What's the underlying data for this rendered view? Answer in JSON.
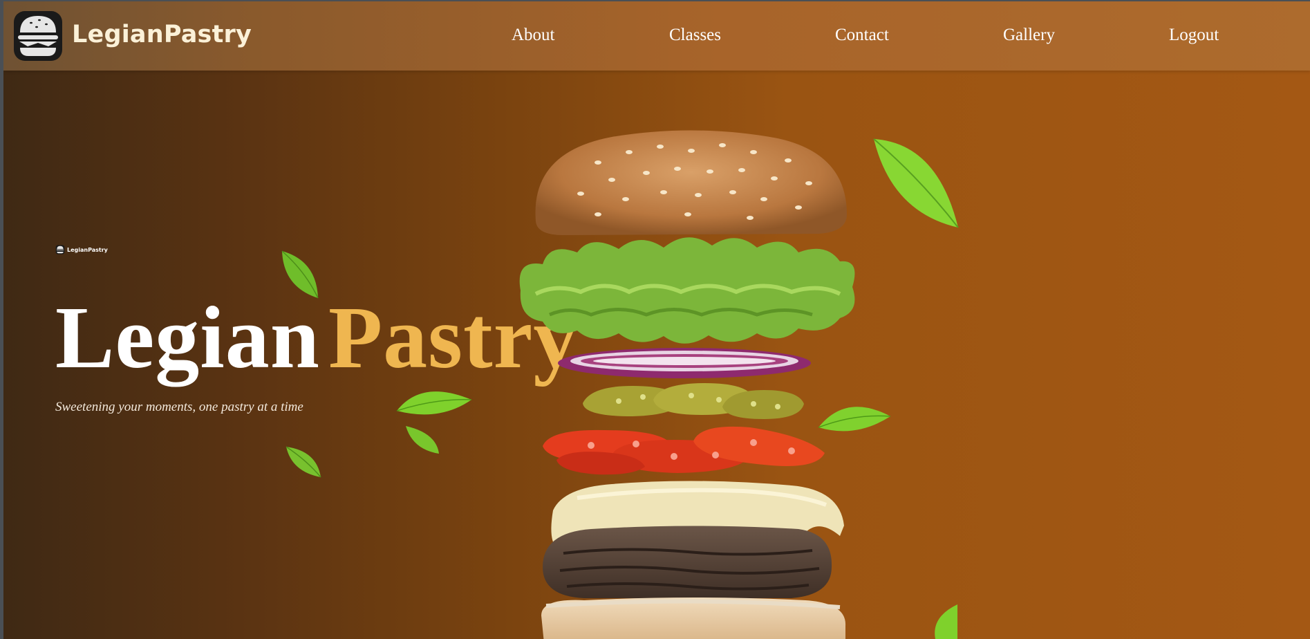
{
  "brand": {
    "name": "LegianPastry",
    "logo_icon": "burger-logo-icon"
  },
  "nav": {
    "links": [
      {
        "label": "About"
      },
      {
        "label": "Classes"
      },
      {
        "label": "Contact"
      },
      {
        "label": "Gallery"
      },
      {
        "label": "Logout"
      }
    ]
  },
  "hero": {
    "mini_logo_text": "LegianPastry",
    "title_part1": "Legian",
    "title_part2": "Pastry",
    "tagline": "Sweetening your moments, one pastry at a time",
    "image": "burger-illustration"
  },
  "colors": {
    "navbar": "#a8642a",
    "background": "#9a5412",
    "accent": "#efb650",
    "text": "#ffffff"
  }
}
